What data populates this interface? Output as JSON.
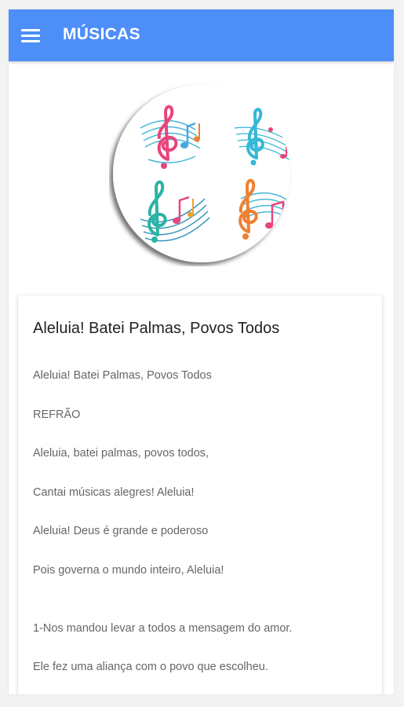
{
  "appbar": {
    "title": "MÚSICAS",
    "background": "#4d8ef8",
    "menu_icon": "hamburger-menu-icon"
  },
  "logo": {
    "icon": "music-notes-logo-icon",
    "clef_colors": [
      "#e8457a",
      "#35b7d6",
      "#2bb3a4",
      "#f08030"
    ]
  },
  "song": {
    "title": "Aleluia! Batei Palmas, Povos Todos",
    "lines": [
      "Aleluia! Batei Palmas, Povos Todos",
      "REFRÃO",
      "Aleluia, batei palmas, povos todos,",
      "Cantai músicas alegres! Aleluia!",
      "Aleluia! Deus é grande e poderoso",
      "Pois governa o mundo inteiro, Aleluia!",
      "1-Nos mandou levar a todos a mensagem do amor.",
      "Ele fez uma aliança com o povo que escolheu."
    ]
  }
}
